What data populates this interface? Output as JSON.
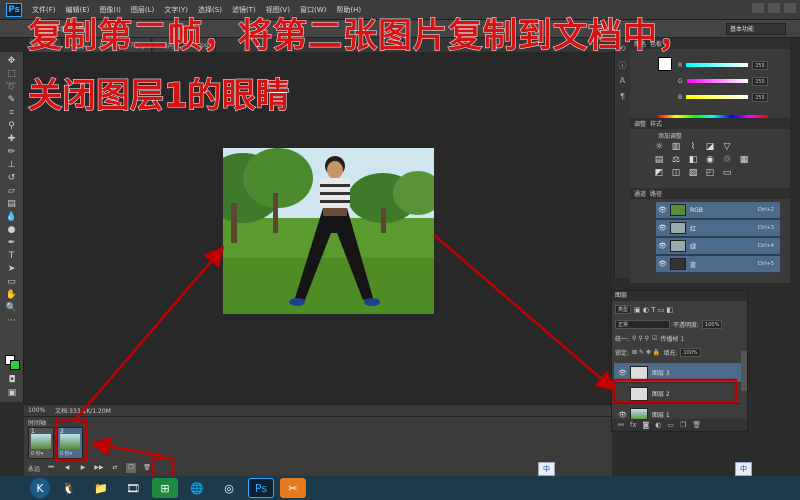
{
  "app": {
    "logo": "Ps"
  },
  "menu": [
    "文件(F)",
    "编辑(E)",
    "图像(I)",
    "图层(L)",
    "文字(Y)",
    "选择(S)",
    "滤镜(T)",
    "视图(V)",
    "窗口(W)",
    "帮助(H)"
  ],
  "options": {
    "show_transform": "显示变换控件",
    "workspace": "基本功能"
  },
  "tabs": [
    "33.jpg",
    "4.jpg",
    "8.jpg",
    "7.jpg",
    "9.jpg",
    "11.jpg"
  ],
  "overlay": {
    "line1": "复制第二帧，将第二张图片复制到文档中，",
    "line2": "关闭图层1的眼睛"
  },
  "status": {
    "zoom": "100%",
    "doc": "文档:333.1K/1.20M"
  },
  "timeline": {
    "title": "时间轴",
    "frames": [
      {
        "num": "1",
        "delay": "0 秒▾"
      },
      {
        "num": "2",
        "delay": "0 秒▾"
      }
    ],
    "loop": "永远"
  },
  "color_panel": {
    "tabs": [
      "颜色",
      "色板"
    ],
    "channels": [
      {
        "label": "R",
        "value": "255"
      },
      {
        "label": "G",
        "value": "255"
      },
      {
        "label": "B",
        "value": "255"
      }
    ]
  },
  "adjust_panel": {
    "tabs": [
      "调整",
      "样式"
    ],
    "title": "添加调整"
  },
  "channels_panel": {
    "tabs": [
      "通道",
      "路径"
    ],
    "rows": [
      {
        "name": "RGB",
        "shortcut": "Ctrl+2"
      },
      {
        "name": "红",
        "shortcut": "Ctrl+3"
      },
      {
        "name": "绿",
        "shortcut": "Ctrl+4"
      },
      {
        "name": "蓝",
        "shortcut": "Ctrl+5"
      }
    ]
  },
  "layers_panel": {
    "title": "图层",
    "kind": "类型",
    "blend": "正常",
    "opacity_label": "不透明度:",
    "opacity": "100%",
    "unify": "统一:",
    "propagate": "传播帧 1",
    "lock": "锁定:",
    "fill_label": "填充:",
    "fill": "100%",
    "layers": [
      {
        "name": "图层 3",
        "visible": true
      },
      {
        "name": "图层 2",
        "visible": false
      },
      {
        "name": "图层 1",
        "visible": true
      }
    ]
  },
  "ime": {
    "label": "中"
  }
}
